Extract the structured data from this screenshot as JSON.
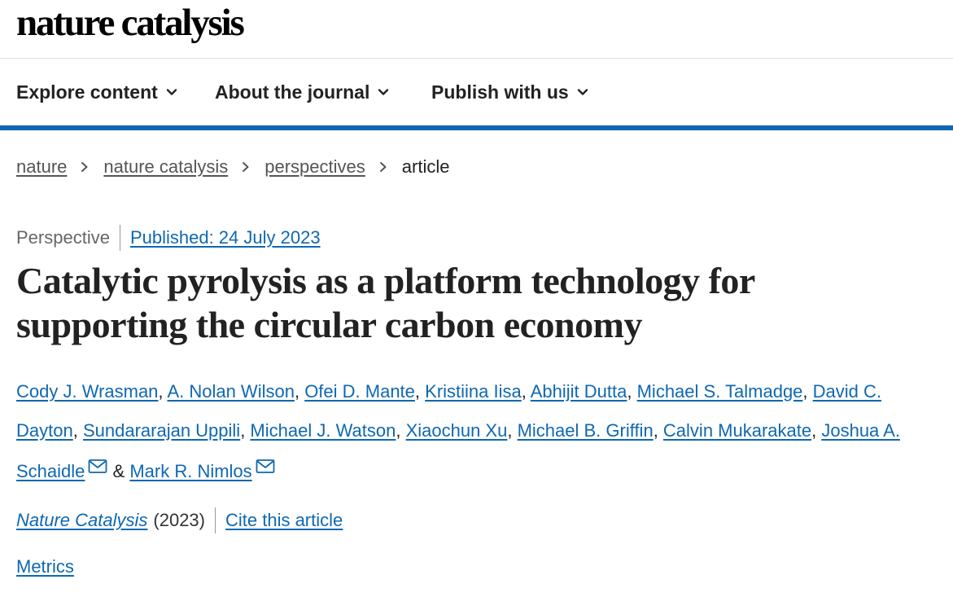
{
  "header": {
    "logo_text": "nature catalysis"
  },
  "nav": {
    "items": [
      {
        "label": "Explore content"
      },
      {
        "label": "About the journal"
      },
      {
        "label": "Publish with us"
      }
    ]
  },
  "breadcrumb": {
    "links": [
      "nature",
      "nature catalysis",
      "perspectives"
    ],
    "current": "article"
  },
  "article": {
    "type": "Perspective",
    "published": "Published: 24 July 2023",
    "title": "Catalytic pyrolysis as a platform technology for supporting the circular carbon economy",
    "authors": [
      "Cody J. Wrasman",
      "A. Nolan Wilson",
      "Ofei D. Mante",
      "Kristiina Iisa",
      "Abhijit Dutta",
      "Michael S. Talmadge",
      "David C. Dayton",
      "Sundararajan Uppili",
      "Michael J. Watson",
      "Xiaochun Xu",
      "Michael B. Griffin",
      "Calvin Mukarakate",
      "Joshua A. Schaidle",
      "Mark R. Nimlos"
    ],
    "separator_and": "&",
    "journal": "Nature Catalysis",
    "year": "(2023)",
    "cite_label": "Cite this article",
    "metrics_label": "Metrics"
  },
  "colors": {
    "link": "#0f68b1",
    "nav_border": "#0f68b1",
    "text": "#222222"
  },
  "icons": {
    "nav_chevron": "chevron-down-icon",
    "breadcrumb_sep": "chevron-right-icon",
    "email": "envelope-icon"
  }
}
